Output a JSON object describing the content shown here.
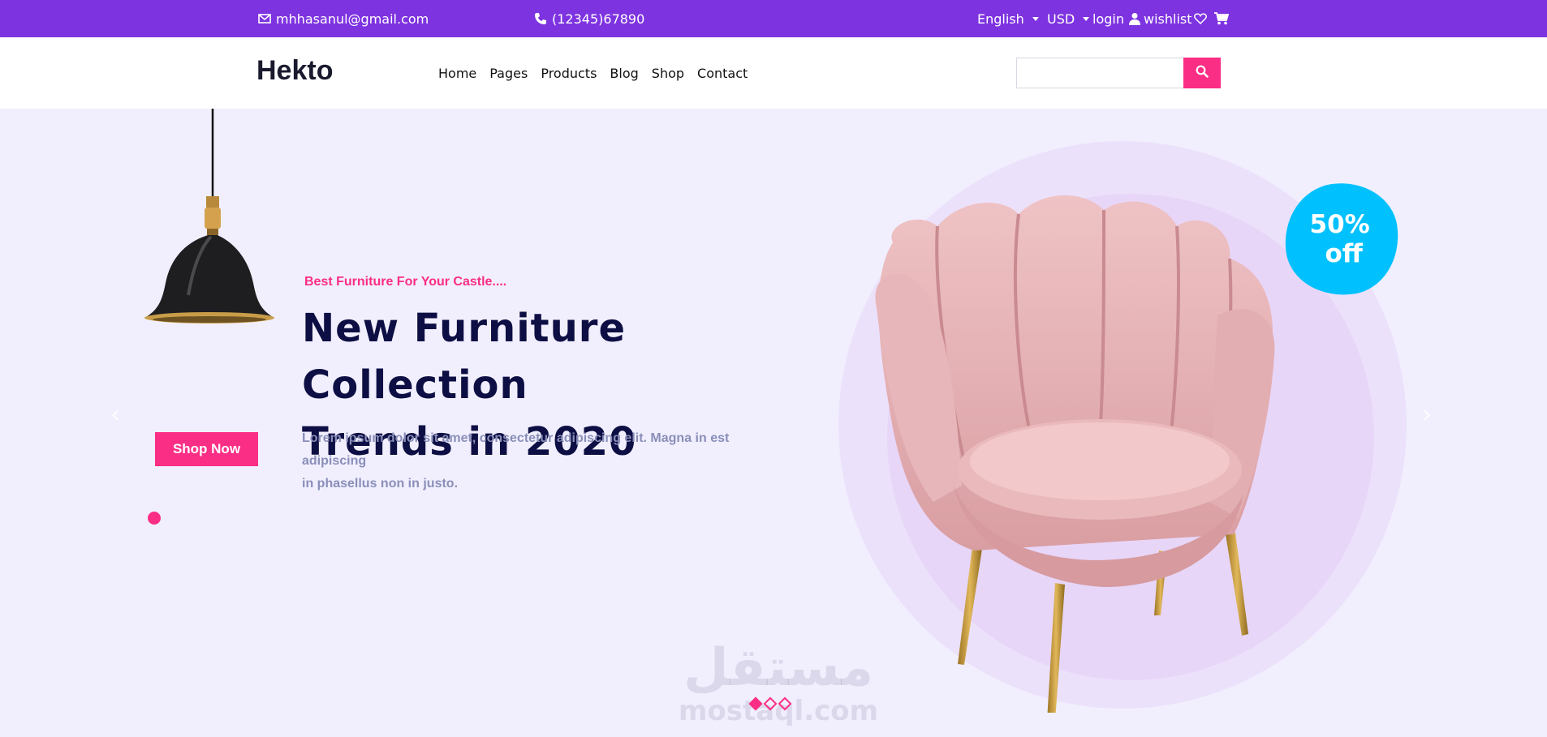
{
  "topbar": {
    "email": "mhhasanul@gmail.com",
    "phone": "(12345)67890",
    "language": "English",
    "currency": "USD",
    "login": "login",
    "wishlist": "wishlist"
  },
  "header": {
    "logo": "Hekto",
    "nav": [
      "Home",
      "Pages",
      "Products",
      "Blog",
      "Shop",
      "Contact"
    ],
    "search_placeholder": ""
  },
  "hero": {
    "subtitle": "Best Furniture For Your Castle....",
    "headline_line1": "New Furniture Collection",
    "headline_line2": "Trends in 2020",
    "description_line1": "Lorem ipsum dolor sit amet, consectetur adipiscing elit. Magna in est adipiscing",
    "description_line2": "in phasellus non in justo.",
    "cta": "Shop Now",
    "badge_line1": "50%",
    "badge_line2": "off",
    "slides_total": 3,
    "slide_active": 1
  },
  "watermark": {
    "arabic": "مستقل",
    "latin": "mostaql.com"
  },
  "colors": {
    "topbar": "#7e33e0",
    "accent": "#fb2e86",
    "heading": "#0d0e43",
    "badge": "#00c1fe",
    "hero_bg": "#f1effe"
  }
}
